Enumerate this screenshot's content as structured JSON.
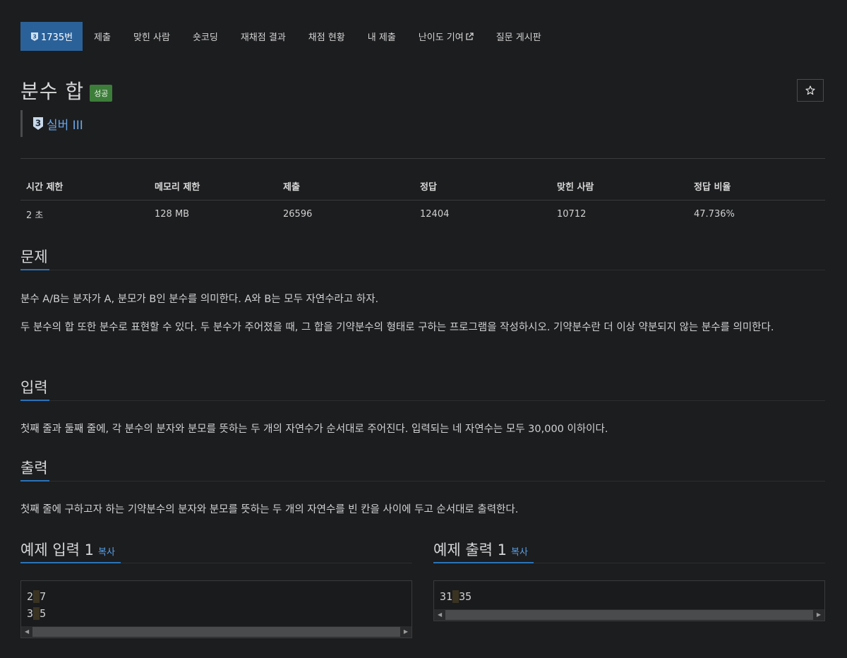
{
  "tabs": [
    {
      "label": "1735번",
      "active": true
    },
    {
      "label": "제출"
    },
    {
      "label": "맞힌 사람"
    },
    {
      "label": "숏코딩"
    },
    {
      "label": "재채점 결과"
    },
    {
      "label": "채점 현황"
    },
    {
      "label": "내 제출"
    },
    {
      "label": "난이도 기여"
    },
    {
      "label": "질문 게시판"
    }
  ],
  "problem": {
    "title": "분수 합",
    "status_badge": "성공",
    "tier_number": "3",
    "tier_label": "실버 III",
    "favorite_icon": "star-icon"
  },
  "info_table": {
    "headers": [
      "시간 제한",
      "메모리 제한",
      "제출",
      "정답",
      "맞힌 사람",
      "정답 비율"
    ],
    "values": [
      "2 초",
      "128 MB",
      "26596",
      "12404",
      "10712",
      "47.736%"
    ]
  },
  "sections": {
    "description": {
      "heading": "문제",
      "paragraphs": [
        "분수 A/B는 분자가 A, 분모가 B인 분수를 의미한다. A와 B는 모두 자연수라고 하자.",
        "두 분수의 합 또한 분수로 표현할 수 있다. 두 분수가 주어졌을 때, 그 합을 기약분수의 형태로 구하는 프로그램을 작성하시오. 기약분수란 더 이상 약분되지 않는 분수를 의미한다."
      ]
    },
    "input": {
      "heading": "입력",
      "text": "첫째 줄과 둘째 줄에, 각 분수의 분자와 분모를 뜻하는 두 개의 자연수가 순서대로 주어진다. 입력되는 네 자연수는 모두 30,000 이하이다."
    },
    "output": {
      "heading": "출력",
      "text": "첫째 줄에 구하고자 하는 기약분수의 분자와 분모를 뜻하는 두 개의 자연수를 빈 칸을 사이에 두고 순서대로 출력한다."
    }
  },
  "samples": {
    "input": {
      "heading": "예제 입력 1",
      "copy_label": "복사",
      "lines": [
        [
          "2",
          "7"
        ],
        [
          "3",
          "5"
        ]
      ]
    },
    "output": {
      "heading": "예제 출력 1",
      "copy_label": "복사",
      "lines": [
        [
          "31",
          "35"
        ]
      ]
    }
  },
  "colors": {
    "accent": "#2b73b8",
    "active_tab": "#2b6199",
    "success": "#3c7d3a",
    "tier_silver": "#6aa6e6"
  }
}
